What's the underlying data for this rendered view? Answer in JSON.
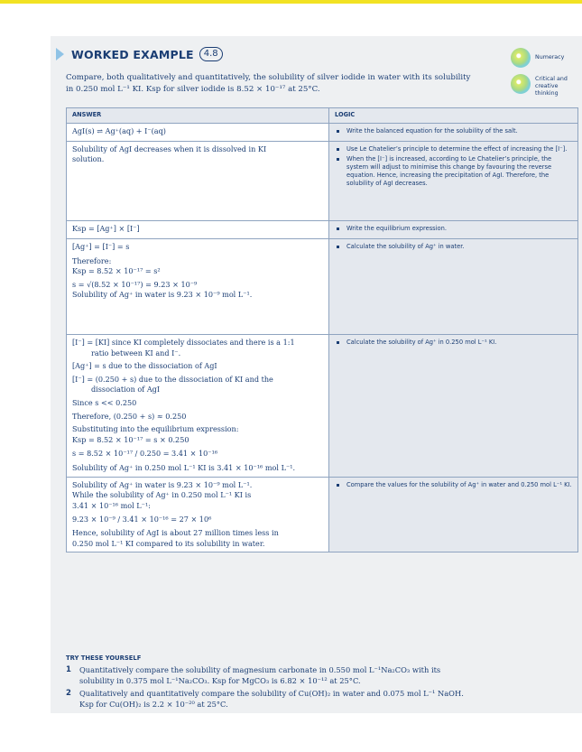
{
  "header": {
    "title": "WORKED EXAMPLE",
    "number": "4.8"
  },
  "badges": [
    {
      "label": "Numeracy"
    },
    {
      "label": "Critical and creative thinking"
    }
  ],
  "question": {
    "line1": "Compare, both qualitatively and quantitatively, the solubility of silver iodide in water with its solubility",
    "line2": "in 0.250 mol L⁻¹ KI. Ksp for silver iodide is 8.52 × 10⁻¹⁷ at 25°C."
  },
  "table": {
    "col_answer": "ANSWER",
    "col_logic": "LOGIC",
    "rows": [
      {
        "answer": [
          "AgI(s) ⇌ Ag⁺(aq) + I⁻(aq)"
        ],
        "logic": [
          "Write the balanced equation for the solubility of the salt."
        ]
      },
      {
        "answer": [
          "Solubility of AgI decreases when it is dissolved in KI",
          "solution."
        ],
        "logic": [
          "Use Le Chatelier’s principle to determine the effect of increasing the [I⁻].",
          "When the [I⁻] is increased, according to Le Chatelier’s principle, the system will adjust to minimise this change by favouring the reverse equation. Hence, increasing the precipitation of AgI. Therefore, the solubility of AgI decreases."
        ]
      },
      {
        "answer": [
          "Ksp = [Ag⁺] × [I⁻]"
        ],
        "logic": [
          "Write the equilibrium expression."
        ]
      },
      {
        "answer": [
          "[Ag⁺] = [I⁻] = s",
          "",
          "Therefore:",
          "Ksp = 8.52 × 10⁻¹⁷ = s²",
          "s = √(8.52 × 10⁻¹⁷) = 9.23 × 10⁻⁹",
          "Solubility of Ag⁺ in water is 9.23 × 10⁻⁹ mol L⁻¹."
        ],
        "logic": [
          "Calculate the solubility of Ag⁺ in water."
        ]
      },
      {
        "answer": [
          "[I⁻] = [KI] since KI completely dissociates and there is a 1:1",
          "ratio between KI and I⁻.",
          "[Ag⁺] = s due to the dissociation of AgI",
          "[I⁻] = (0.250 + s) due to the dissociation of KI and the",
          "dissociation of AgI",
          "Since s << 0.250",
          "Therefore, (0.250 + s) ≈ 0.250",
          "Substituting into the equilibrium expression:",
          "Ksp = 8.52 × 10⁻¹⁷ = s × 0.250",
          "s = 8.52 × 10⁻¹⁷ / 0.250 = 3.41 × 10⁻¹⁶",
          "Solubility of Ag⁺ in 0.250 mol L⁻¹ KI is 3.41 × 10⁻¹⁶ mol L⁻¹."
        ],
        "logic": [
          "Calculate the solubility of Ag⁺ in 0.250 mol L⁻¹ KI."
        ]
      },
      {
        "answer": [
          "Solubility of Ag⁺ in water is 9.23 × 10⁻⁹ mol L⁻¹.",
          "While the solubility of Ag⁺ in 0.250 mol L⁻¹ KI is",
          "3.41 × 10⁻¹⁶ mol L⁻¹:",
          "9.23 × 10⁻⁹ / 3.41 × 10⁻¹⁶ = 27 × 10⁶",
          "Hence, solubility of AgI is about 27 million times less in",
          "0.250 mol L⁻¹ KI compared to its solubility in water."
        ],
        "logic": [
          "Compare the values for the solubility of Ag⁺ in water and 0.250 mol L⁻¹ KI."
        ]
      }
    ]
  },
  "try": {
    "heading": "TRY THESE YOURSELF",
    "items": [
      {
        "n": "1",
        "line1": "Quantitatively compare the solubility of magnesium carbonate in 0.550 mol L⁻¹Na₂CO₃ with its",
        "line2": "solubility in 0.375 mol L⁻¹Na₂CO₃. Ksp for MgCO₃ is 6.82 × 10⁻¹² at 25°C."
      },
      {
        "n": "2",
        "line1": "Qualitatively and quantitatively compare the solubility of Cu(OH)₂ in water and 0.075 mol L⁻¹ NaOH.",
        "line2": "Ksp for Cu(OH)₂ is 2.2 × 10⁻²⁰ at 25°C."
      }
    ]
  }
}
